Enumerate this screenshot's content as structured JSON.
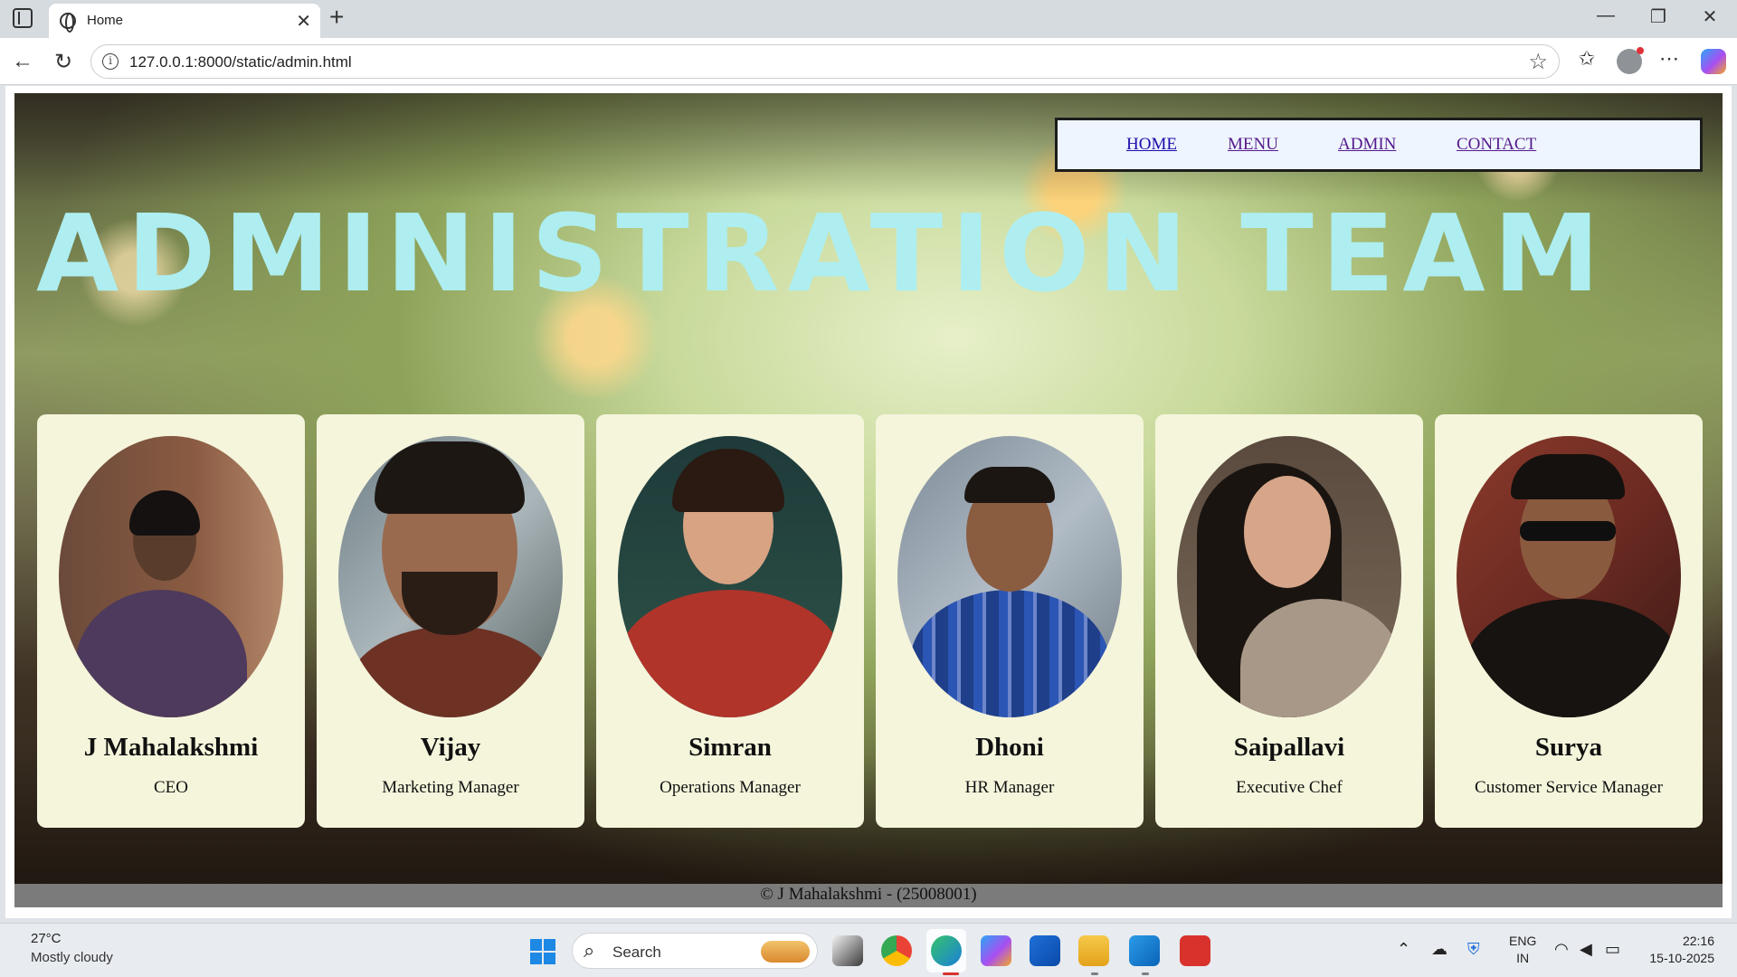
{
  "browser": {
    "tab_title": "Home",
    "url": "127.0.0.1:8000/static/admin.html",
    "icons": [
      "tab-actions-icon",
      "globe-icon",
      "close-icon",
      "plus-icon",
      "minimize-icon",
      "restore-icon",
      "close-window-icon",
      "back-icon",
      "refresh-icon",
      "site-info-icon",
      "favorite-star-icon",
      "favorites-icon",
      "profile-icon",
      "more-icon",
      "copilot-icon"
    ]
  },
  "nav": {
    "home": "HOME",
    "menu": "MENU",
    "admin": "ADMIN",
    "contact": "CONTACT"
  },
  "heading": "ADMINISTRATION TEAM",
  "team": [
    {
      "name": "J Mahalakshmi",
      "role": "CEO"
    },
    {
      "name": "Vijay",
      "role": "Marketing Manager"
    },
    {
      "name": "Simran",
      "role": "Operations Manager"
    },
    {
      "name": "Dhoni",
      "role": "HR Manager"
    },
    {
      "name": "Saipallavi",
      "role": "Executive Chef"
    },
    {
      "name": "Surya",
      "role": "Customer Service Manager"
    }
  ],
  "footer": "© J Mahalakshmi - (25008001)",
  "taskbar": {
    "weather_temp": "27°C",
    "weather_desc": "Mostly cloudy",
    "search_label": "Search",
    "lang_line1": "ENG",
    "lang_line2": "IN",
    "time": "22:16",
    "date": "15-10-2025"
  },
  "colors": {
    "heading": "#aeeef0",
    "card_bg": "#f5f5dc",
    "nav_bg": "#eef5ff",
    "footer_bg": "#7b7b7b",
    "link": "#1a0dab",
    "visited_link": "#551a8b"
  }
}
